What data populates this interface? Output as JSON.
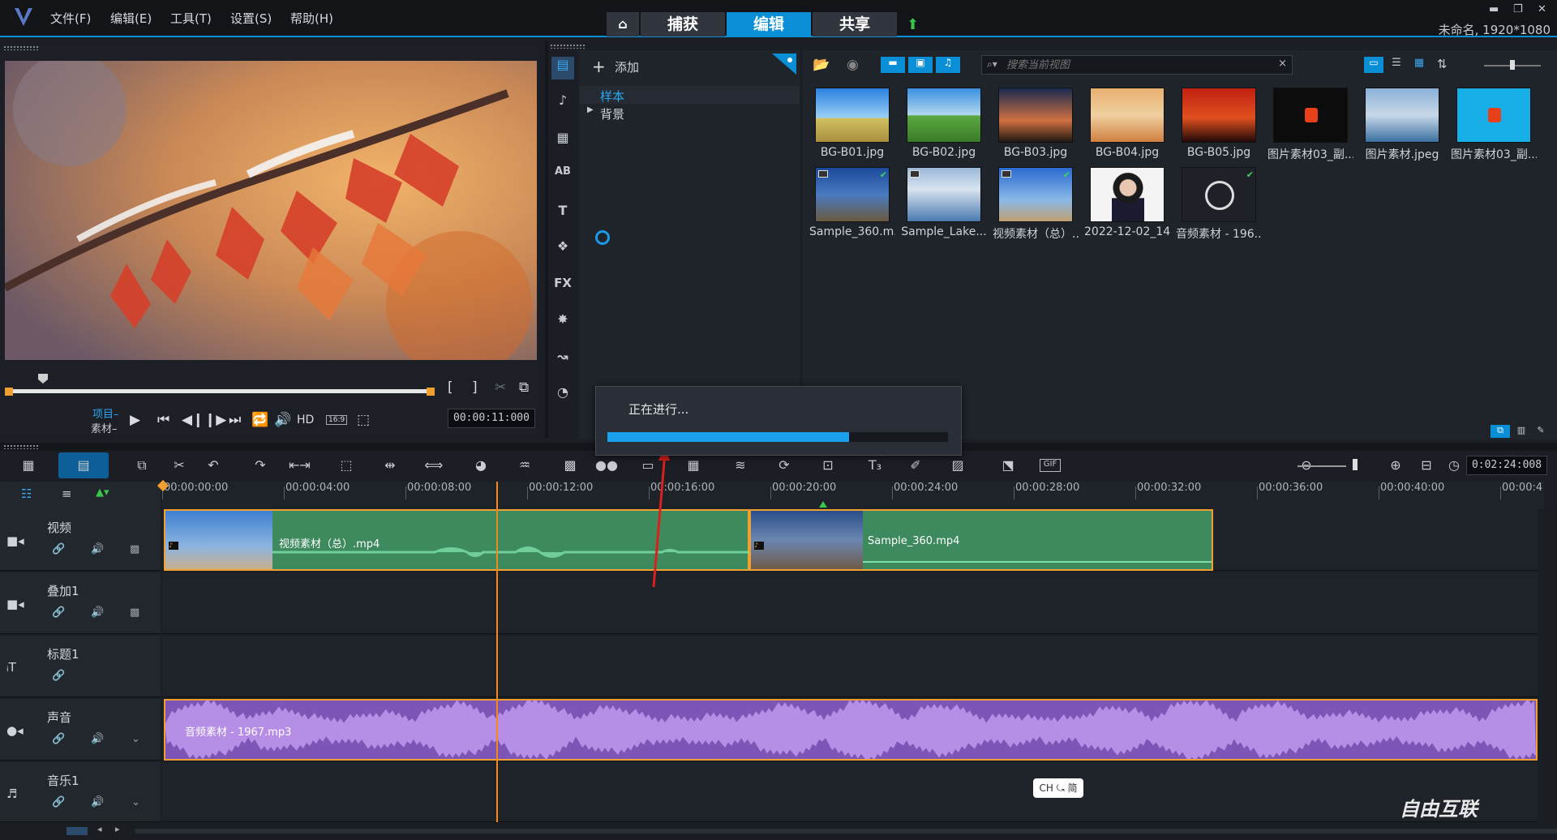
{
  "menu": {
    "items": [
      "文件(F)",
      "编辑(E)",
      "工具(T)",
      "设置(S)",
      "帮助(H)"
    ]
  },
  "tabs": {
    "capture": "捕获",
    "edit": "编辑",
    "share": "共享"
  },
  "project_info": "未命名, 1920*1080",
  "player": {
    "mode_project": "项目–",
    "mode_clip": "素材–",
    "hd": "HD",
    "aspect": "16:9",
    "timecode": "00:00:11:000"
  },
  "library": {
    "add_label": "添加",
    "tree": [
      "样本",
      "背景"
    ],
    "search_placeholder": "搜索当前视图",
    "thumbnails": [
      "BG-B01.jpg",
      "BG-B02.jpg",
      "BG-B03.jpg",
      "BG-B04.jpg",
      "BG-B05.jpg",
      "图片素材03_副...",
      "图片素材.jpeg",
      "图片素材03_副...",
      "Sample_360.m...",
      "Sample_Lake...",
      "视频素材（总）...",
      "2022-12-02_14...",
      "音频素材 - 196..."
    ]
  },
  "progress": {
    "label": "正在进行...",
    "value": 0.71
  },
  "timeline": {
    "timecode": "0:02:24:008",
    "ruler": [
      "00:00:00:00",
      "00:00:04:00",
      "00:00:08:00",
      "00:00:12:00",
      "00:00:16:00",
      "00:00:20:00",
      "00:00:24:00",
      "00:00:28:00",
      "00:00:32:00",
      "00:00:36:00",
      "00:00:40:00",
      "00:00:4"
    ],
    "tracks": [
      "视频",
      "叠加1",
      "标题1",
      "声音",
      "音乐1"
    ],
    "clips": {
      "video1": "视频素材（总）.mp4",
      "video2": "Sample_360.mp4",
      "audio": "音频素材 - 1967.mp3"
    }
  },
  "ime": "CH ⤿ 简",
  "watermark": "自由互联"
}
